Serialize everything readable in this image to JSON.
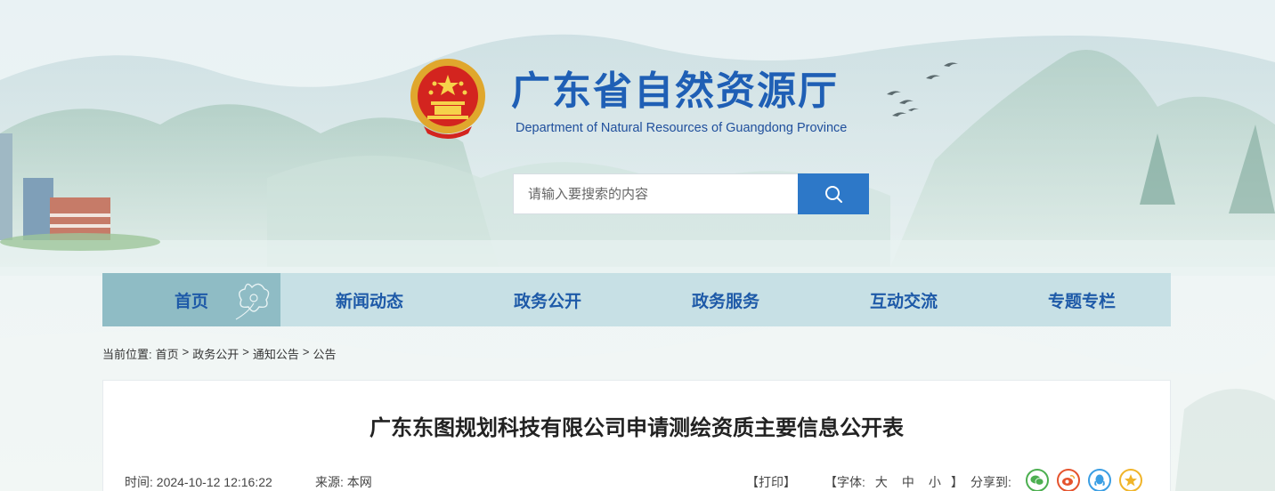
{
  "header": {
    "title": "广东省自然资源厅",
    "subtitle": "Department of Natural Resources of Guangdong Province"
  },
  "search": {
    "placeholder": "请输入要搜索的内容",
    "icon": "search-icon"
  },
  "nav": {
    "items": [
      {
        "label": "首页",
        "active": true
      },
      {
        "label": "新闻动态",
        "active": false
      },
      {
        "label": "政务公开",
        "active": false
      },
      {
        "label": "政务服务",
        "active": false
      },
      {
        "label": "互动交流",
        "active": false
      },
      {
        "label": "专题专栏",
        "active": false
      }
    ]
  },
  "breadcrumb": {
    "prefix": "当前位置:",
    "items": [
      "首页",
      "政务公开",
      "通知公告",
      "公告"
    ],
    "separator": ">"
  },
  "article": {
    "title": "广东东图规划科技有限公司申请测绘资质主要信息公开表",
    "time_label": "时间:",
    "time": "2024-10-12 12:16:22",
    "source_label": "来源:",
    "source": "本网",
    "print": "【打印】",
    "font_label": "【字体:",
    "font_sizes": [
      "大",
      "中",
      "小"
    ],
    "font_close": "】",
    "share_label": "分享到:",
    "share_icons": [
      "wechat-icon",
      "weibo-icon",
      "qq-icon",
      "qzone-icon"
    ]
  },
  "colors": {
    "brand_blue": "#1f5fb5",
    "search_button": "#2d78c8",
    "nav_bg": "#bfdce2",
    "nav_active": "#8fbcc5",
    "wechat": "#4caf50",
    "weibo": "#e5532d",
    "qq": "#3a9ee3",
    "qzone": "#f0b429"
  }
}
